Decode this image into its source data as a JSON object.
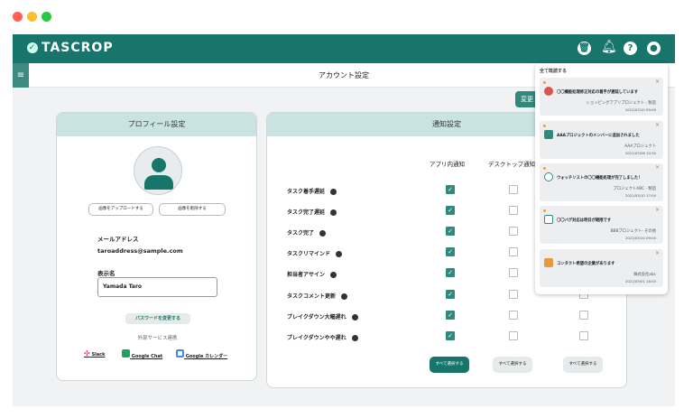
{
  "window": {
    "controls": [
      "#ff5f57",
      "#febc2e",
      "#28c840"
    ]
  },
  "header": {
    "logo": "TASCROP",
    "icons": [
      "trash-icon",
      "bell-icon",
      "help-icon",
      "user-icon"
    ]
  },
  "page": {
    "title": "アカウント設定",
    "change_button": "変更"
  },
  "profile": {
    "title": "プロフィール設定",
    "upload_button": "画像をアップロードする",
    "delete_button": "画像を削除する",
    "email_label": "メールアドレス",
    "email": "taroaddress@sample.com",
    "name_label": "表示名",
    "name_value": "Yamada Taro",
    "password_button": "パスワードを変更する",
    "external_label": "外部サービス連携",
    "services": [
      {
        "name": "Slack"
      },
      {
        "name": "Google Chat"
      },
      {
        "name": "Google カレンダー"
      }
    ]
  },
  "notifications": {
    "title": "通知設定",
    "columns": [
      "アプリ内通知",
      "デスクトップ通知"
    ],
    "rows": [
      {
        "label": "タスク着手遅延",
        "app": true,
        "desktop": false,
        "other": false
      },
      {
        "label": "タスク完了遅延",
        "app": true,
        "desktop": false,
        "other": false
      },
      {
        "label": "タスク完了",
        "app": true,
        "desktop": false,
        "other": false
      },
      {
        "label": "タスクリマインド",
        "app": true,
        "desktop": false,
        "other": false
      },
      {
        "label": "担当者アサイン",
        "app": true,
        "desktop": false,
        "other": false
      },
      {
        "label": "タスクコメント更新",
        "app": true,
        "desktop": false,
        "other": false
      },
      {
        "label": "ブレイクダウン大幅遅れ",
        "app": true,
        "desktop": false,
        "other": false
      },
      {
        "label": "ブレイクダウンやや遅れ",
        "app": true,
        "desktop": false,
        "other": false
      }
    ],
    "select_all": [
      "すべて選択する",
      "すべて選択する",
      "すべて選択する"
    ]
  },
  "popup": {
    "mark_all_read": "全て既読する",
    "items": [
      {
        "message": "〇〇機能処理修正対応の着手が遅延しています",
        "project": "ショッピングアプリプロジェクト - 製造",
        "date": "2022/03/10 09:00",
        "icon": "alert-icon",
        "unread": true
      },
      {
        "message": "AAAプロジェクトのメンバーに追加されました",
        "project": "AAAプロジェクト",
        "date": "2021/03/06 10:30",
        "icon": "list-icon",
        "unread": true
      },
      {
        "message": "ウォッチリストの〇〇機能処理が完了しました！",
        "project": "プロジェクトABC - 製造",
        "date": "2022/03/10 17:00",
        "icon": "check-circle-icon",
        "unread": true
      },
      {
        "message": "〇〇バグ対応は明日が期限です",
        "project": "BBBプロジェクト- その他",
        "date": "2022/03/10 09:00",
        "icon": "calendar-clock-icon",
        "unread": true
      },
      {
        "message": "コンタクト希望の企業があります",
        "project": "株式会社abc",
        "date": "2022/03/01 18:00",
        "icon": "building-icon",
        "unread": false
      }
    ]
  }
}
